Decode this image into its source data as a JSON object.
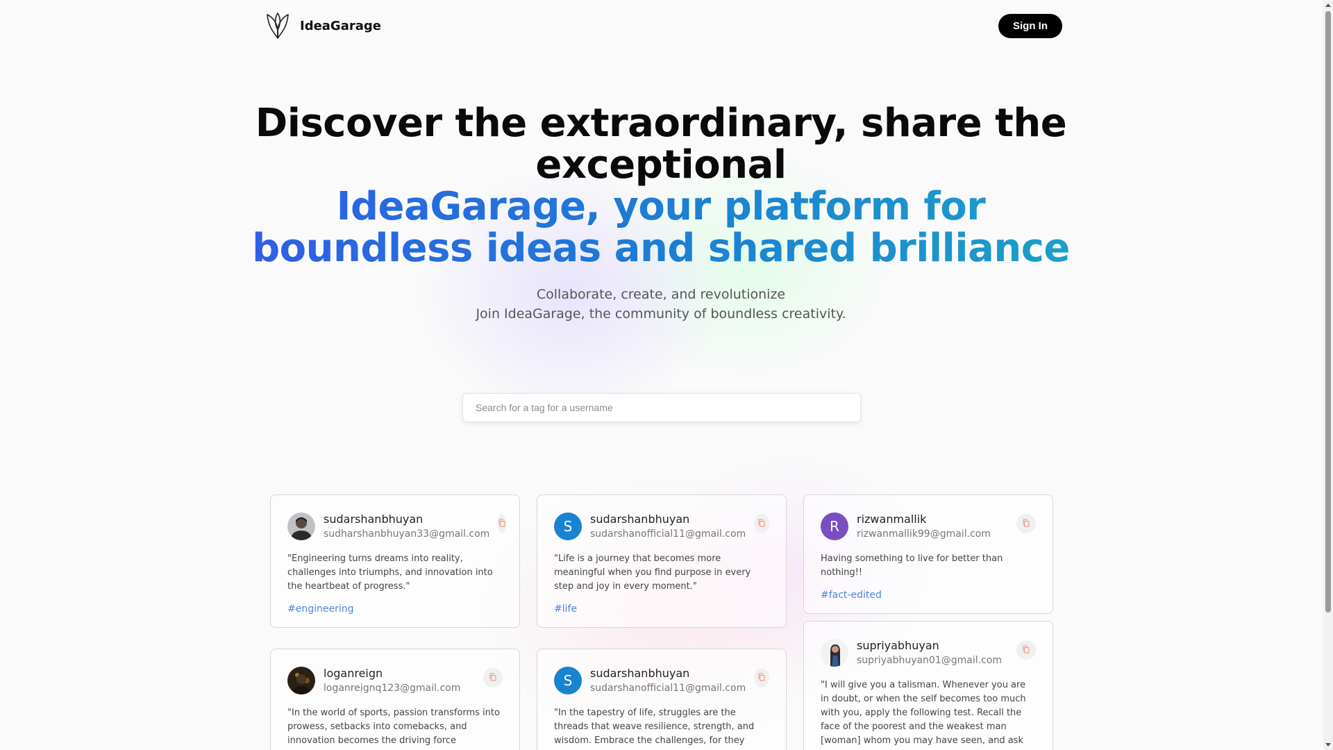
{
  "brand": {
    "name": "IdeaGarage"
  },
  "nav": {
    "signin_label": "Sign In"
  },
  "hero": {
    "line1": "Discover the extraordinary, share the",
    "line2": "exceptional",
    "highlight1": "IdeaGarage, your platform for",
    "highlight2": "boundless ideas and shared brilliance",
    "sub1": "Collaborate, create, and revolutionize",
    "sub2": "Join IdeaGarage, the community of boundless creativity."
  },
  "search": {
    "placeholder": "Search for a tag for a username",
    "value": ""
  },
  "colors": {
    "avatar_blue": "#1883d0",
    "avatar_purple": "#7a4ec2",
    "tag_blue": "#4a86d8",
    "gradient_start": "#2f5fe6",
    "gradient_end": "#1aa0c8"
  },
  "posts": [
    {
      "username": "sudarshanbhuyan",
      "email": "sudharshanbhuyan33@gmail.com",
      "quote": "\"Engineering turns dreams into reality, challenges into triumphs, and innovation into the heartbeat of progress.\"",
      "tag": "#engineering",
      "avatar": "photo"
    },
    {
      "username": "sudarshanbhuyan",
      "email": "sudarshanofficial11@gmail.com",
      "quote": "\"Life is a journey that becomes more meaningful when you find purpose in every step and joy in every moment.\"",
      "tag": "#life",
      "avatar": "S"
    },
    {
      "username": "rizwanmallik",
      "email": "rizwanmallik99@gmail.com",
      "quote": "Having something to live for better than nothing!!",
      "tag": "#fact-edited",
      "avatar": "R"
    },
    {
      "username": "loganreign",
      "email": "loganreignq123@gmail.com",
      "quote": "\"In the world of sports, passion transforms into prowess, setbacks into comebacks, and innovation becomes the driving force propelling",
      "tag": "",
      "avatar": "photo"
    },
    {
      "username": "sudarshanbhuyan",
      "email": "sudarshanofficial11@gmail.com",
      "quote": "\"In the tapestry of life, struggles are the threads that weave resilience, strength, and wisdom. Embrace the challenges, for they sculpt the",
      "tag": "",
      "avatar": "S"
    },
    {
      "username": "supriyabhuyan",
      "email": "supriyabhuyan01@gmail.com",
      "quote": "\"I will give you a talisman. Whenever you are in doubt, or when the self becomes too much with you, apply the following test. Recall the face of the poorest and the weakest man [woman] whom you may have seen, and ask yourself, if the step",
      "tag": "",
      "avatar": "photo"
    }
  ]
}
